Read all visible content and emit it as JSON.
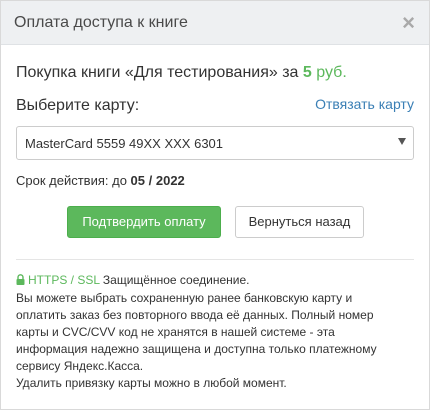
{
  "header": {
    "title": "Оплата доступа к книге",
    "close_glyph": "×"
  },
  "purchase": {
    "prefix": "Покупка книги «Для тестирования» за ",
    "price": "5",
    "currency": "руб."
  },
  "card_section": {
    "label": "Выберите карту:",
    "unlink_link": "Отвязать карту",
    "selected_card": "MasterCard 5559 49XX XXX 6301"
  },
  "expiry": {
    "prefix": "Срок действия: до ",
    "month": "05",
    "separator": " / ",
    "year": "2022"
  },
  "buttons": {
    "confirm": "Подтвердить оплату",
    "back": "Вернуться назад"
  },
  "security": {
    "https_label": "HTTPS / SSL",
    "secure_text": " Защищённое соединение.",
    "lines": [
      "Вы можете выбрать сохраненную ранее банковскую карту и",
      "оплатить заказ без повторного ввода её данных. Полный номер",
      "карты и CVC/CVV код не хранятся в нашей системе - эта",
      "информация надежно защищена и доступна только платежному",
      "сервису Яндекс.Касса.",
      "Удалить привязку карты можно в любой момент."
    ]
  },
  "colors": {
    "accent_green": "#5cb85c",
    "link_blue": "#3a7fb5",
    "header_bg": "#eef0f2"
  },
  "icons": {
    "close": "close-icon",
    "lock": "lock-icon",
    "dropdown": "chevron-down-icon"
  }
}
